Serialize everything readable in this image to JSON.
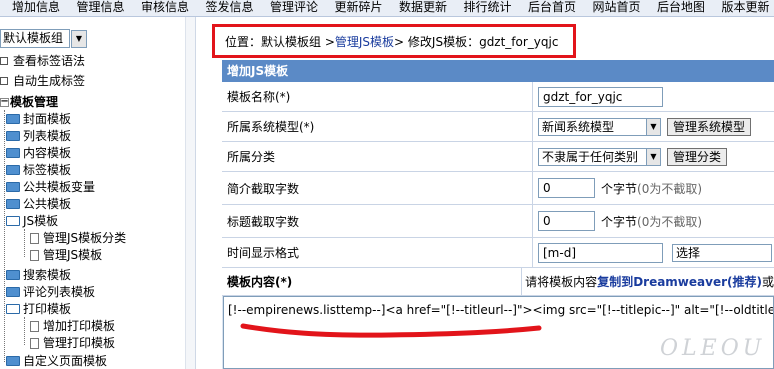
{
  "topnav": [
    "增加信息",
    "管理信息",
    "审核信息",
    "签发信息",
    "管理评论",
    "更新碎片",
    "数据更新",
    "排行统计",
    "后台首页",
    "网站首页",
    "后台地图",
    "版本更新"
  ],
  "sidebar": {
    "group_select": "默认模板组",
    "items": [
      {
        "label": "查看标签语法"
      },
      {
        "label": "自动生成标签"
      },
      {
        "label": "模板管理"
      },
      {
        "label": "封面模板"
      },
      {
        "label": "列表模板"
      },
      {
        "label": "内容模板"
      },
      {
        "label": "标签模板"
      },
      {
        "label": "公共模板变量"
      },
      {
        "label": "公共模板"
      },
      {
        "label": "JS模板"
      },
      {
        "label": "管理JS模板分类"
      },
      {
        "label": "管理JS模板"
      },
      {
        "label": "搜索模板"
      },
      {
        "label": "评论列表模板"
      },
      {
        "label": "打印模板"
      },
      {
        "label": "增加打印模板"
      },
      {
        "label": "管理打印模板"
      },
      {
        "label": "自定义页面模板"
      }
    ]
  },
  "breadcrumb": {
    "prefix": "位置：默认模板组 > ",
    "link": "管理JS模板",
    "suffix": " > 修改JS模板：gdzt_for_yqjc"
  },
  "form": {
    "title": "增加JS模板",
    "name_label": "模板名称(*)",
    "name_value": "gdzt_for_yqjc",
    "model_label": "所属系统模型(*)",
    "model_value": "新闻系统模型",
    "model_button": "管理系统模型",
    "class_label": "所属分类",
    "class_value": "不隶属于任何类别",
    "class_button": "管理分类",
    "intro_label": "简介截取字数",
    "intro_value": "0",
    "intro_unit": "个字节",
    "intro_hint": "(0为不截取)",
    "title_label": "标题截取字数",
    "title_value": "0",
    "title_unit": "个字节",
    "title_hint": "(0为不截取)",
    "time_label": "时间显示格式",
    "time_value": "[m-d]",
    "time_select": "选择",
    "content_label": "模板内容(*)",
    "content_hint_pre": "请将模板内容",
    "content_hint_link": "复制到Dreamweaver(推荐)",
    "content_hint_post": "或",
    "content_code": "[!--empirenews.listtemp--]<a href=\"[!--titleurl--]\"><img src=\"[!--titlepic--]\" alt=\"[!--oldtitle--]\" title=\"[!--oldtitle--]\" />"
  },
  "watermark": "OLEOU",
  "colors": {
    "highlight_box": "#e2141a",
    "form_header": "#5b8ac6",
    "link": "#1a3c9e"
  }
}
